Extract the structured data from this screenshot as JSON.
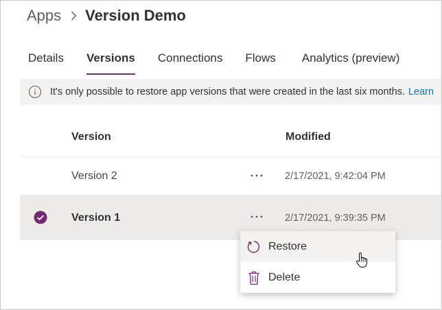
{
  "breadcrumb": {
    "root": "Apps",
    "current": "Version Demo"
  },
  "tabs": [
    {
      "label": "Details",
      "active": false
    },
    {
      "label": "Versions",
      "active": true
    },
    {
      "label": "Connections",
      "active": false
    },
    {
      "label": "Flows",
      "active": false
    },
    {
      "label": "Analytics (preview)",
      "active": false
    }
  ],
  "info": {
    "icon": "info-icon",
    "text": "It's only possible to restore app versions that were created in the last six months.",
    "link": "Learn"
  },
  "table": {
    "columns": {
      "version": "Version",
      "modified": "Modified"
    },
    "rows": [
      {
        "version": "Version 2",
        "modified": "2/17/2021, 9:42:04 PM",
        "selected": false
      },
      {
        "version": "Version 1",
        "modified": "2/17/2021, 9:39:35 PM",
        "selected": true
      }
    ]
  },
  "context_menu": {
    "items": [
      {
        "label": "Restore",
        "icon": "restore-icon"
      },
      {
        "label": "Delete",
        "icon": "trash-icon"
      }
    ]
  },
  "colors": {
    "accent": "#742774",
    "link": "#0078d4",
    "infobar_bg": "#f3f2f1",
    "selected_row_bg": "#edebe9"
  }
}
